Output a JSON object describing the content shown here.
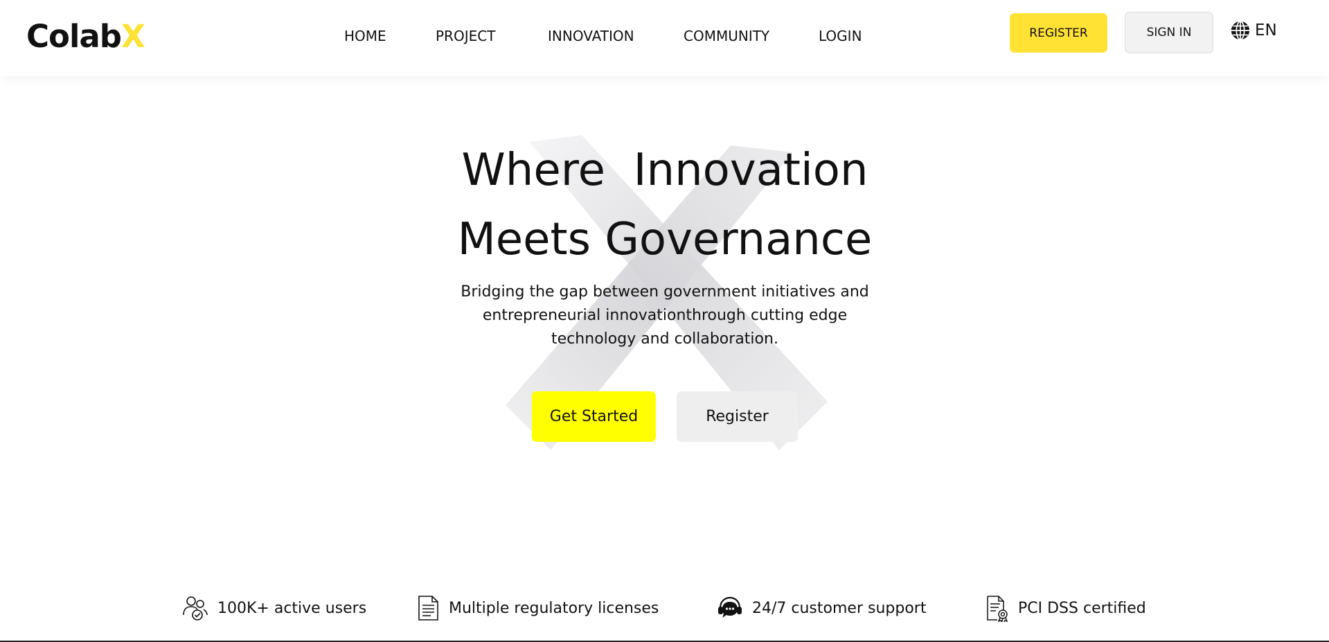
{
  "brand": {
    "logo_main": "Colab",
    "logo_accent": "X",
    "accent_color": "#ffe234"
  },
  "nav": {
    "items": [
      {
        "label": "HOME"
      },
      {
        "label": "PROJECT"
      },
      {
        "label": "INNOVATION"
      },
      {
        "label": "COMMUNITY"
      },
      {
        "label": "LOGIN"
      }
    ]
  },
  "header_actions": {
    "register_label": "REGISTER",
    "signin_label": "SIGN IN",
    "language": "EN",
    "language_icon": "globe-icon"
  },
  "hero": {
    "title_line1": "Where  Innovation",
    "title_line2": "Meets Governance",
    "subtitle_lines": [
      "Bridging the gap between government initiatives and",
      "entrepreneurial innovationthrough cutting edge",
      "technology and collaboration."
    ],
    "primary_cta": "Get Started",
    "secondary_cta": "Register",
    "primary_color": "#ffff00",
    "background_graphic": "x-logo-graphic"
  },
  "features": [
    {
      "icon": "users-check-icon",
      "label": "100K+ active users"
    },
    {
      "icon": "document-icon",
      "label": "Multiple regulatory licenses"
    },
    {
      "icon": "support-chat-icon",
      "label": "24/7 customer support"
    },
    {
      "icon": "certificate-icon",
      "label": "PCI DSS certified"
    }
  ]
}
